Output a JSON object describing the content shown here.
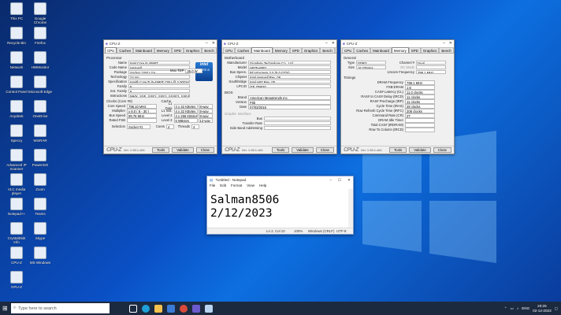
{
  "desktop": {
    "icons": [
      {
        "label": "This PC"
      },
      {
        "label": "Recycle Bin"
      },
      {
        "label": "Network"
      },
      {
        "label": "Control Panel"
      },
      {
        "label": "Anydesk"
      },
      {
        "label": "Speccy"
      },
      {
        "label": "Advanced IP Scanner"
      },
      {
        "label": "VLC media player"
      },
      {
        "label": "Notepad++"
      },
      {
        "label": "CrystalDisk Info"
      },
      {
        "label": "CPU-Z"
      },
      {
        "label": "GPU-Z"
      },
      {
        "label": "Google Chrome"
      },
      {
        "label": "Firefox"
      },
      {
        "label": "HWMonitor"
      },
      {
        "label": "Microsoft Edge"
      },
      {
        "label": "OneDrive"
      },
      {
        "label": "WinRAR"
      },
      {
        "label": "PowerISO"
      },
      {
        "label": "Zoom"
      },
      {
        "label": "Teams"
      },
      {
        "label": "Skype"
      },
      {
        "label": "MS Windows"
      }
    ]
  },
  "cpuz1": {
    "title": "CPU-Z",
    "tabs": [
      "CPU",
      "Caches",
      "Mainboard",
      "Memory",
      "SPD",
      "Graphics",
      "Bench",
      "About"
    ],
    "active": 0,
    "processor_heading": "Processor",
    "fields": [
      {
        "k": "Name",
        "v": "Intel Core i5 4590T"
      },
      {
        "k": "Code Name",
        "v": "Haswell"
      },
      {
        "k": "Package",
        "v": "Socket 1150 LGA"
      },
      {
        "k": "Technology",
        "v": "22 nm"
      },
      {
        "k": "Specification",
        "v": "Intel® Core™ i5-4590T CPU @ 2.00GHz"
      },
      {
        "k": "Family",
        "v": "6"
      },
      {
        "k": "Ext. Family",
        "v": "6"
      },
      {
        "k": "Instructions",
        "v": "MMX, SSE, SSE2, SSE3, SSSE3, SSE4.1, SSE4.2, EM64T, VT-x, AES, AVX, AVX2, FMA3"
      }
    ],
    "max_tdp_k": "Max TDP",
    "max_tdp": "35.0 W",
    "clocks_heading": "Clocks (Core #0)",
    "clocks": [
      {
        "k": "Core Speed",
        "v": "798.10 MHz"
      },
      {
        "k": "Multiplier",
        "v": "x 8.0 ( 8 - 30 )"
      },
      {
        "k": "Bus Speed",
        "v": "99.76 MHz"
      },
      {
        "k": "Rated FSB",
        "v": ""
      }
    ],
    "cache_heading": "Cache",
    "cache": [
      {
        "k": "L1 Data",
        "v": "4 x 32 KBytes",
        "w": "8-way"
      },
      {
        "k": "L1 Inst.",
        "v": "4 x 32 KBytes",
        "w": "8-way"
      },
      {
        "k": "Level 2",
        "v": "4 x 256 KBytes",
        "w": "8-way"
      },
      {
        "k": "Level 3",
        "v": "6 MBytes",
        "w": "12-way"
      }
    ],
    "selection_k": "Selection",
    "selection": "Socket #1",
    "cores_k": "Cores",
    "cores": "4",
    "threads_k": "Threads",
    "threads": "4",
    "logo_brand": "intel",
    "logo_product": "CORE i5",
    "ver": "Ver. 1.96.1.x64",
    "tools": "Tools",
    "validate": "Validate",
    "close": "Close"
  },
  "cpuz2": {
    "title": "CPU-Z",
    "tabs": [
      "CPU",
      "Caches",
      "Mainboard",
      "Memory",
      "SPD",
      "Graphics",
      "Bench",
      "About"
    ],
    "active": 2,
    "mb_heading": "Motherboard",
    "fields": [
      {
        "k": "Manufacturer",
        "v": "Gigabyte Technology Co., Ltd."
      },
      {
        "k": "Model",
        "v": "H97N-WIFI"
      },
      {
        "k": "Bus Specs.",
        "v": "PCI-Express 2.0 (5.0 GT/s)"
      },
      {
        "k": "Chipset",
        "v": "Intel    Haswell    Rev. 06"
      },
      {
        "k": "Southbridge",
        "v": "Intel    H97    Rev. 00"
      },
      {
        "k": "LPCIO",
        "v": "ITE    IT8620"
      }
    ],
    "bios_heading": "BIOS",
    "bios": [
      {
        "k": "Brand",
        "v": "American Megatrends Inc."
      },
      {
        "k": "Version",
        "v": "F6b"
      },
      {
        "k": "Date",
        "v": "07/03/2016"
      }
    ],
    "gi_heading": "Graphic Interface",
    "gi": [
      {
        "k": "Bus",
        "v": ""
      },
      {
        "k": "Transfer Rate",
        "v": ""
      },
      {
        "k": "Side Band Addressing",
        "v": ""
      }
    ],
    "ver": "Ver. 1.96.1.x64",
    "tools": "Tools",
    "validate": "Validate",
    "close": "Close"
  },
  "cpuz3": {
    "title": "CPU-Z",
    "tabs": [
      "CPU",
      "Caches",
      "Mainboard",
      "Memory",
      "SPD",
      "Graphics",
      "Bench",
      "About"
    ],
    "active": 3,
    "gen_heading": "General",
    "type_k": "Type",
    "type": "DDR3",
    "channel_k": "Channel #",
    "channel": "Dual",
    "size_k": "Size",
    "size": "16 GBytes",
    "dc_k": "DC Mode",
    "uncore_k": "Uncore Frequency",
    "uncore": "798.1 MHz",
    "timings_heading": "Timings",
    "timings": [
      {
        "k": "DRAM Frequency",
        "v": "798.1 MHz"
      },
      {
        "k": "FSB:DRAM",
        "v": "1:6"
      },
      {
        "k": "CAS# Latency (CL)",
        "v": "11.0 clocks"
      },
      {
        "k": "RAS# to CAS# Delay (tRCD)",
        "v": "11 clocks"
      },
      {
        "k": "RAS# Precharge (tRP)",
        "v": "11 clocks"
      },
      {
        "k": "Cycle Time (tRAS)",
        "v": "28 clocks"
      },
      {
        "k": "Row Refresh Cycle Time (tRFC)",
        "v": "208 clocks"
      },
      {
        "k": "Command Rate (CR)",
        "v": "2T"
      },
      {
        "k": "DRAM Idle Timer",
        "v": ""
      },
      {
        "k": "Total CAS# (tRDRAM)",
        "v": ""
      },
      {
        "k": "Row To Column (tRCD)",
        "v": ""
      }
    ],
    "ver": "Ver. 1.96.1.x64",
    "tools": "Tools",
    "validate": "Validate",
    "close": "Close"
  },
  "notepad": {
    "title": "*Untitled - Notepad",
    "menu": [
      "File",
      "Edit",
      "Format",
      "View",
      "Help"
    ],
    "line1": "Salman8506",
    "line2": "2/12/2023",
    "status": {
      "pos": "Ln 2, Col 10",
      "zoom": "100%",
      "eol": "Windows (CRLF)",
      "enc": "UTF-8"
    }
  },
  "taskbar": {
    "search_placeholder": "Type here to search",
    "lang": "ENG",
    "time": "20:25",
    "date": "02-12-2023"
  }
}
